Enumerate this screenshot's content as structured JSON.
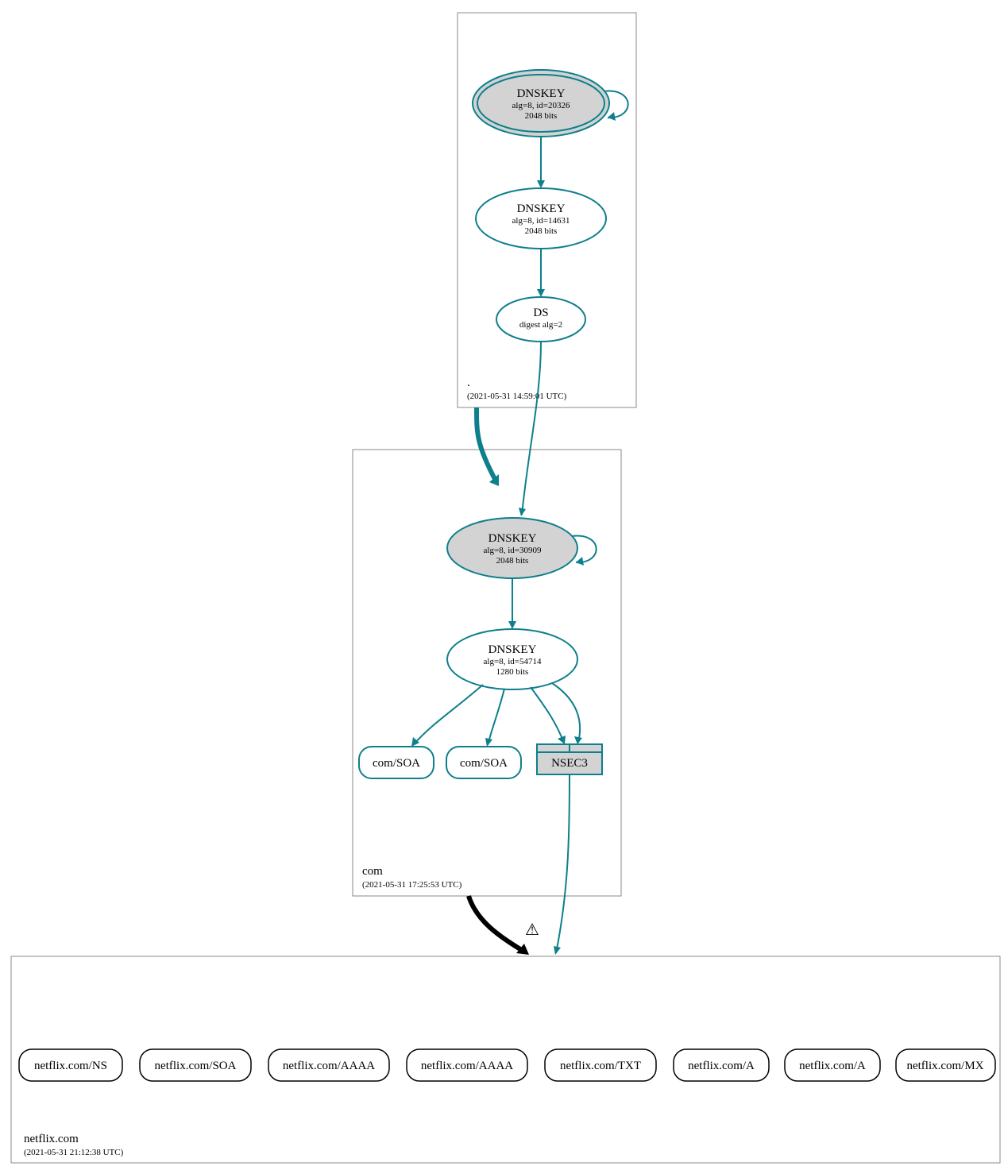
{
  "root_zone": {
    "label": ".",
    "timestamp": "(2021-05-31 14:59:01 UTC)",
    "ksk": {
      "title": "DNSKEY",
      "line1": "alg=8, id=20326",
      "line2": "2048 bits"
    },
    "zsk": {
      "title": "DNSKEY",
      "line1": "alg=8, id=14631",
      "line2": "2048 bits"
    },
    "ds": {
      "title": "DS",
      "line1": "digest alg=2"
    }
  },
  "com_zone": {
    "label": "com",
    "timestamp": "(2021-05-31 17:25:53 UTC)",
    "ksk": {
      "title": "DNSKEY",
      "line1": "alg=8, id=30909",
      "line2": "2048 bits"
    },
    "zsk": {
      "title": "DNSKEY",
      "line1": "alg=8, id=54714",
      "line2": "1280 bits"
    },
    "soa1": "com/SOA",
    "soa2": "com/SOA",
    "nsec3": "NSEC3"
  },
  "netflix_zone": {
    "label": "netflix.com",
    "timestamp": "(2021-05-31 21:12:38 UTC)",
    "records": [
      "netflix.com/NS",
      "netflix.com/SOA",
      "netflix.com/AAAA",
      "netflix.com/AAAA",
      "netflix.com/TXT",
      "netflix.com/A",
      "netflix.com/A",
      "netflix.com/MX"
    ]
  },
  "warning": "⚠"
}
